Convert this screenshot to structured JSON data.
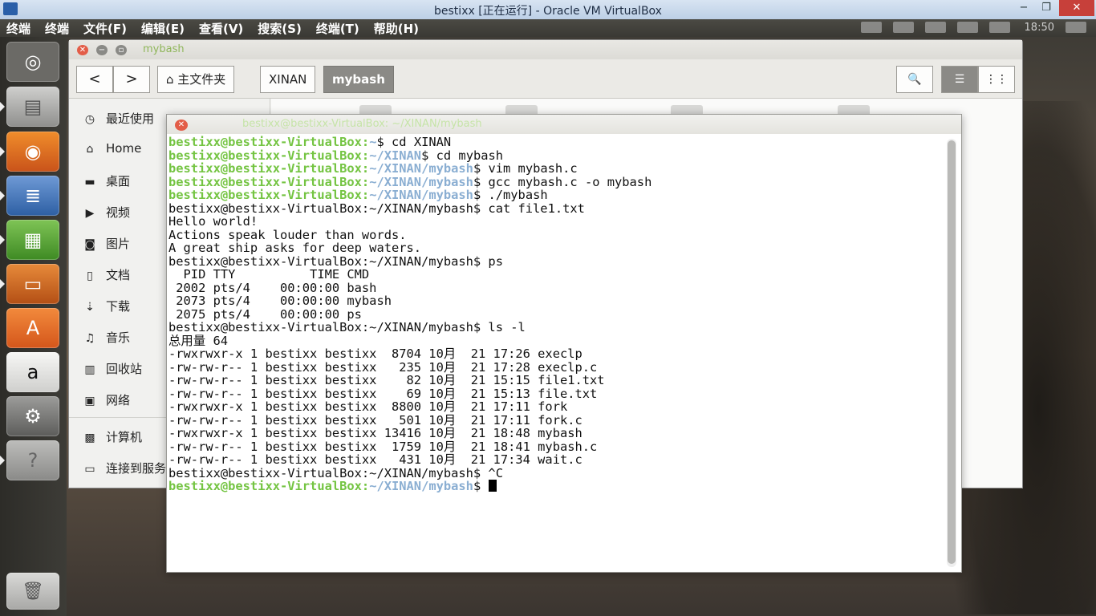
{
  "vbox": {
    "title": "bestixx [正在运行] - Oracle VM VirtualBox",
    "minimize": "−",
    "maximize": "❐",
    "close": "✕"
  },
  "panel": {
    "menu": [
      "终端",
      "终端",
      "文件(F)",
      "编辑(E)",
      "查看(V)",
      "搜索(S)",
      "终端(T)",
      "帮助(H)"
    ],
    "clock": "18:50"
  },
  "launcher": {
    "items": [
      "ubuntu-dash",
      "files",
      "firefox",
      "writer",
      "calc",
      "impress",
      "software-center",
      "amazon",
      "system-settings",
      "help",
      "trash"
    ]
  },
  "files": {
    "window_title": "mybash",
    "back": "<",
    "forward": ">",
    "breadcrumbs": [
      "主文件夹",
      "XINAN",
      "mybash"
    ],
    "sidebar": [
      "最近使用",
      "Home",
      "桌面",
      "视频",
      "图片",
      "文档",
      "下载",
      "音乐",
      "回收站",
      "网络",
      "计算机",
      "连接到服务器"
    ]
  },
  "terminal": {
    "title": "bestixx@bestixx-VirtualBox: ~/XINAN/mybash",
    "prompt_user": "bestixx@bestixx-VirtualBox",
    "lines": [
      {
        "type": "prompt",
        "path": "~",
        "cmd": " cd XINAN"
      },
      {
        "type": "prompt",
        "path": "~/XINAN",
        "cmd": " cd mybash"
      },
      {
        "type": "prompt",
        "path": "~/XINAN/mybash",
        "cmd": " vim mybash.c"
      },
      {
        "type": "prompt",
        "path": "~/XINAN/mybash",
        "cmd": " gcc mybash.c -o mybash"
      },
      {
        "type": "prompt",
        "path": "~/XINAN/mybash",
        "cmd": " ./mybash"
      },
      {
        "type": "text",
        "text": "bestixx@bestixx-VirtualBox:~/XINAN/mybash$ cat file1.txt"
      },
      {
        "type": "text",
        "text": "Hello world!"
      },
      {
        "type": "text",
        "text": "Actions speak louder than words."
      },
      {
        "type": "text",
        "text": "A great ship asks for deep waters."
      },
      {
        "type": "text",
        "text": "bestixx@bestixx-VirtualBox:~/XINAN/mybash$ ps"
      },
      {
        "type": "text",
        "text": "  PID TTY          TIME CMD"
      },
      {
        "type": "text",
        "text": " 2002 pts/4    00:00:00 bash"
      },
      {
        "type": "text",
        "text": " 2073 pts/4    00:00:00 mybash"
      },
      {
        "type": "text",
        "text": " 2075 pts/4    00:00:00 ps"
      },
      {
        "type": "text",
        "text": "bestixx@bestixx-VirtualBox:~/XINAN/mybash$ ls -l"
      },
      {
        "type": "text",
        "text": "总用量 64"
      },
      {
        "type": "text",
        "text": "-rwxrwxr-x 1 bestixx bestixx  8704 10月  21 17:26 execlp"
      },
      {
        "type": "text",
        "text": "-rw-rw-r-- 1 bestixx bestixx   235 10月  21 17:28 execlp.c"
      },
      {
        "type": "text",
        "text": "-rw-rw-r-- 1 bestixx bestixx    82 10月  21 15:15 file1.txt"
      },
      {
        "type": "text",
        "text": "-rw-rw-r-- 1 bestixx bestixx    69 10月  21 15:13 file.txt"
      },
      {
        "type": "text",
        "text": "-rwxrwxr-x 1 bestixx bestixx  8800 10月  21 17:11 fork"
      },
      {
        "type": "text",
        "text": "-rw-rw-r-- 1 bestixx bestixx   501 10月  21 17:11 fork.c"
      },
      {
        "type": "text",
        "text": "-rwxrwxr-x 1 bestixx bestixx 13416 10月  21 18:48 mybash"
      },
      {
        "type": "text",
        "text": "-rw-rw-r-- 1 bestixx bestixx  1759 10月  21 18:41 mybash.c"
      },
      {
        "type": "text",
        "text": "-rw-rw-r-- 1 bestixx bestixx   431 10月  21 17:34 wait.c"
      },
      {
        "type": "text",
        "text": "bestixx@bestixx-VirtualBox:~/XINAN/mybash$ ^C"
      },
      {
        "type": "prompt",
        "path": "~/XINAN/mybash",
        "cmd": " ",
        "cursor": true
      }
    ]
  },
  "colors": {
    "prompt_user": "#74c442",
    "prompt_path": "#8aaed2"
  }
}
